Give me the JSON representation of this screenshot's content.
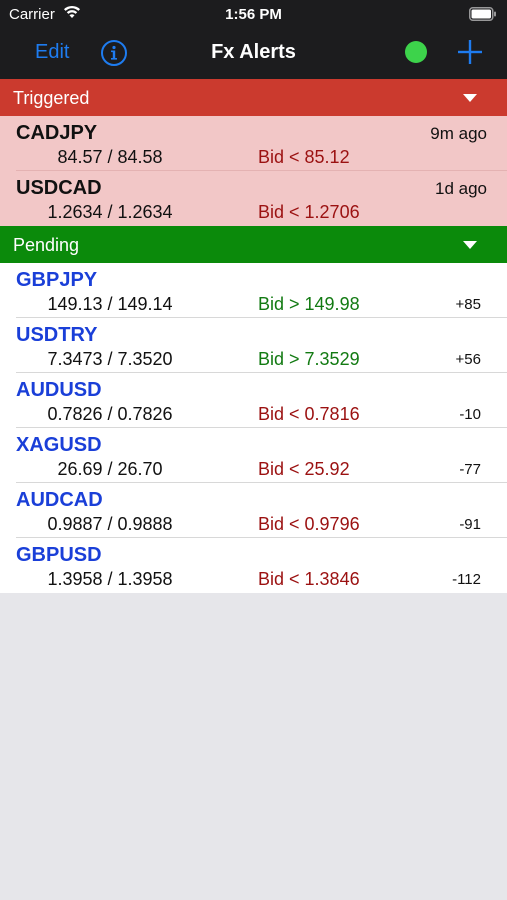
{
  "status_bar": {
    "carrier": "Carrier",
    "time": "1:56 PM"
  },
  "nav": {
    "edit": "Edit",
    "title": "Fx Alerts",
    "connection_color": "#3dd34b"
  },
  "sections": {
    "triggered": "Triggered",
    "pending": "Pending"
  },
  "triggered": [
    {
      "pair": "CADJPY",
      "quote": "84.57 / 84.58",
      "condition": "Bid < 85.12",
      "age": "9m ago"
    },
    {
      "pair": "USDCAD",
      "quote": "1.2634 / 1.2634",
      "condition": "Bid < 1.2706",
      "age": "1d ago"
    }
  ],
  "pending": [
    {
      "pair": "GBPJPY",
      "quote": "149.13 / 149.14",
      "condition": "Bid > 149.98",
      "delta": "+85"
    },
    {
      "pair": "USDTRY",
      "quote": "7.3473 / 7.3520",
      "condition": "Bid > 7.3529",
      "delta": "+56"
    },
    {
      "pair": "AUDUSD",
      "quote": "0.7826 / 0.7826",
      "condition": "Bid < 0.7816",
      "delta": "-10"
    },
    {
      "pair": "XAGUSD",
      "quote": "26.69 / 26.70",
      "condition": "Bid < 25.92",
      "delta": "-77"
    },
    {
      "pair": "AUDCAD",
      "quote": "0.9887 / 0.9888",
      "condition": "Bid < 0.9796",
      "delta": "-91"
    },
    {
      "pair": "GBPUSD",
      "quote": "1.3958 / 1.3958",
      "condition": "Bid < 1.3846",
      "delta": "-112"
    }
  ]
}
